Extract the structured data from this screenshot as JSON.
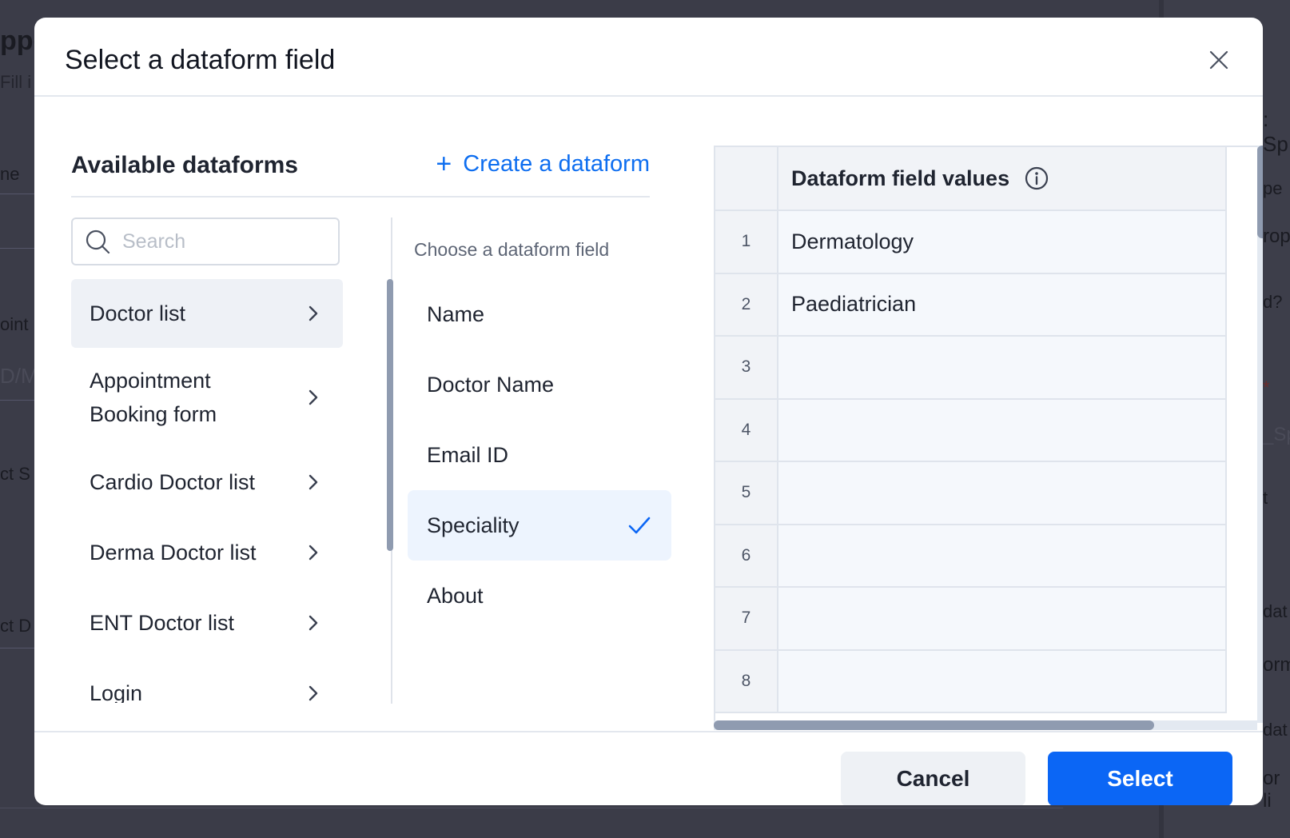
{
  "background": {
    "fragments": [
      "ppo",
      "Fill i",
      "ne",
      "oint",
      "D/M",
      "ct S",
      "ct D",
      ": Sp",
      "pe",
      "rop",
      "d?",
      "*",
      "_Sp",
      "t",
      "dat",
      "orm",
      "dat",
      "or li"
    ]
  },
  "modal": {
    "title": "Select a dataform field",
    "close_icon": "close-icon"
  },
  "left": {
    "title": "Available dataforms",
    "create_label": "Create a dataform",
    "search_placeholder": "Search",
    "dataforms": [
      {
        "label": "Doctor list",
        "active": true
      },
      {
        "label": "Appointment Booking form",
        "active": false
      },
      {
        "label": "Cardio Doctor list",
        "active": false
      },
      {
        "label": "Derma Doctor list",
        "active": false
      },
      {
        "label": "ENT Doctor list",
        "active": false
      },
      {
        "label": "Login",
        "active": false
      }
    ]
  },
  "middle": {
    "choose_label": "Choose a dataform field",
    "fields": [
      {
        "label": "Name",
        "selected": false
      },
      {
        "label": "Doctor Name",
        "selected": false
      },
      {
        "label": "Email ID",
        "selected": false
      },
      {
        "label": "Speciality",
        "selected": true
      },
      {
        "label": "About",
        "selected": false
      }
    ]
  },
  "table": {
    "header": "Dataform field values",
    "rows": [
      {
        "num": "1",
        "value": "Dermatology"
      },
      {
        "num": "2",
        "value": "Paediatrician"
      },
      {
        "num": "3",
        "value": ""
      },
      {
        "num": "4",
        "value": ""
      },
      {
        "num": "5",
        "value": ""
      },
      {
        "num": "6",
        "value": ""
      },
      {
        "num": "7",
        "value": ""
      },
      {
        "num": "8",
        "value": ""
      }
    ]
  },
  "footer": {
    "cancel_label": "Cancel",
    "select_label": "Select"
  },
  "colors": {
    "accent": "#0b66f5",
    "overlay": "#3a3b47"
  }
}
